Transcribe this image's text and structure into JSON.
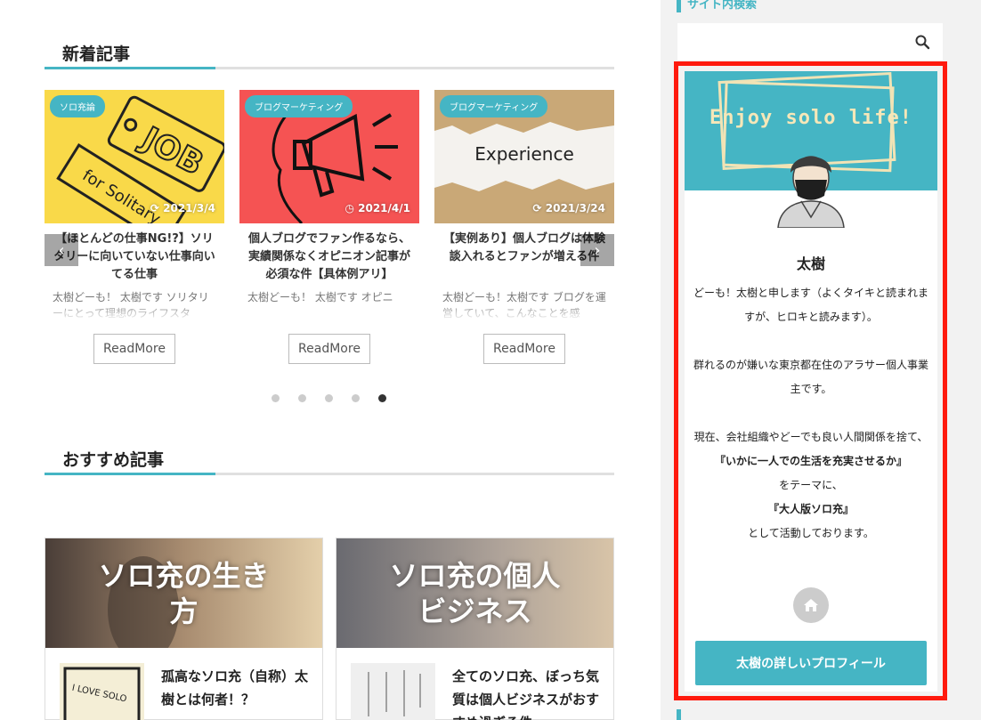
{
  "colors": {
    "accent": "#45b5c4",
    "highlight": "#ff1a0e",
    "yellow": "#f9d949",
    "red": "#f55353"
  },
  "new_posts": {
    "title": "新着記事",
    "cards": [
      {
        "category": "ソロ充論",
        "date": "2021/3/4",
        "date_icon": "refresh-icon",
        "title": "【ほとんどの仕事NG!?】ソリタリーに向いていない仕事向いてる仕事",
        "excerpt": "太樹どーも！ 太樹です ソリタリーにとって理想のライフスタ",
        "readmore": "ReadMore"
      },
      {
        "category": "ブログマーケティング",
        "date": "2021/4/1",
        "date_icon": "clock-icon",
        "title": "個人ブログでファン作るなら、実績関係なくオピニオン記事が必須な件【具体例アリ】",
        "excerpt": "太樹どーも！ 太樹です オピニ",
        "readmore": "ReadMore"
      },
      {
        "category": "ブログマーケティング",
        "date": "2021/3/24",
        "date_icon": "refresh-icon",
        "title": "【実例あり】個人ブログは体験談入れるとファンが増える件",
        "excerpt": "太樹どーも！太樹です ブログを運営していて、こんなことを感",
        "readmore": "ReadMore"
      }
    ],
    "thumb_texts": {
      "job": "JOB",
      "solitary": "for Solitary",
      "experience": "Experience"
    },
    "dots": [
      false,
      false,
      false,
      false,
      true
    ]
  },
  "recommended": {
    "title": "おすすめ記事",
    "cards": [
      {
        "hero": "ソロ充の生き方",
        "title": "孤高なソロ充（自称）太樹とは何者！？",
        "thumb_text": "I LOVE SOLO"
      },
      {
        "hero": "ソロ充の個人ビジネス",
        "title": "全てのソロ充、ぼっち気質は個人ビジネスがおすすめ過ぎる件"
      }
    ]
  },
  "sidebar": {
    "top_label": "サイト内検索",
    "search": {
      "placeholder": "",
      "value": ""
    },
    "profile": {
      "banner": "Enjoy solo life!",
      "name": "太樹",
      "bio": [
        {
          "text": "どーも！太樹と申します（よくタイキと読まれますが、ヒロキと読みます）。",
          "bold": false
        },
        {
          "text": "",
          "bold": false
        },
        {
          "text": "群れるのが嫌いな東京都在住のアラサー個人事業主です。",
          "bold": false
        },
        {
          "text": "",
          "bold": false
        },
        {
          "text": "現在、会社組織やどーでも良い人間関係を捨て、",
          "bold": false
        },
        {
          "text": "『いかに一人での生活を充実させるか』",
          "bold": true
        },
        {
          "text": "をテーマに、",
          "bold": false
        },
        {
          "text": "『大人版ソロ充』",
          "bold": true
        },
        {
          "text": "として活動しております。",
          "bold": false
        }
      ],
      "home_icon": "home-icon",
      "cta": "太樹の詳しいプロフィール"
    }
  }
}
